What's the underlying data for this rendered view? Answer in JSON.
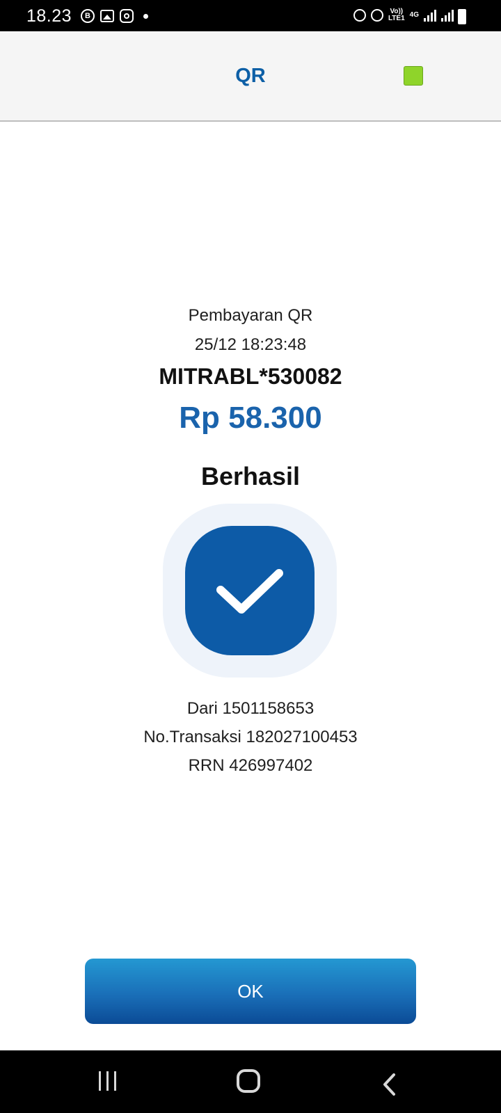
{
  "status_bar": {
    "time": "18.23",
    "badge_letter": "B",
    "network_top": "Vo))",
    "network_bottom": "LTE1",
    "network_type": "4G"
  },
  "header": {
    "title": "QR",
    "accent_color": "#8fd42a"
  },
  "transaction": {
    "type": "Pembayaran QR",
    "datetime": "25/12 18:23:48",
    "merchant": "MITRABL*530082",
    "amount": "Rp 58.300",
    "status": "Berhasil",
    "from": "Dari 1501158653",
    "transaction_no": "No.Transaksi 182027100453",
    "rrn": "RRN 426997402"
  },
  "actions": {
    "ok_label": "OK"
  },
  "colors": {
    "primary": "#0d5ba7",
    "amount": "#1a63ac",
    "check_bg": "#eef3fa"
  },
  "icons": {
    "status": "check-icon",
    "nav": [
      "recent-apps-icon",
      "home-icon",
      "back-icon"
    ]
  }
}
